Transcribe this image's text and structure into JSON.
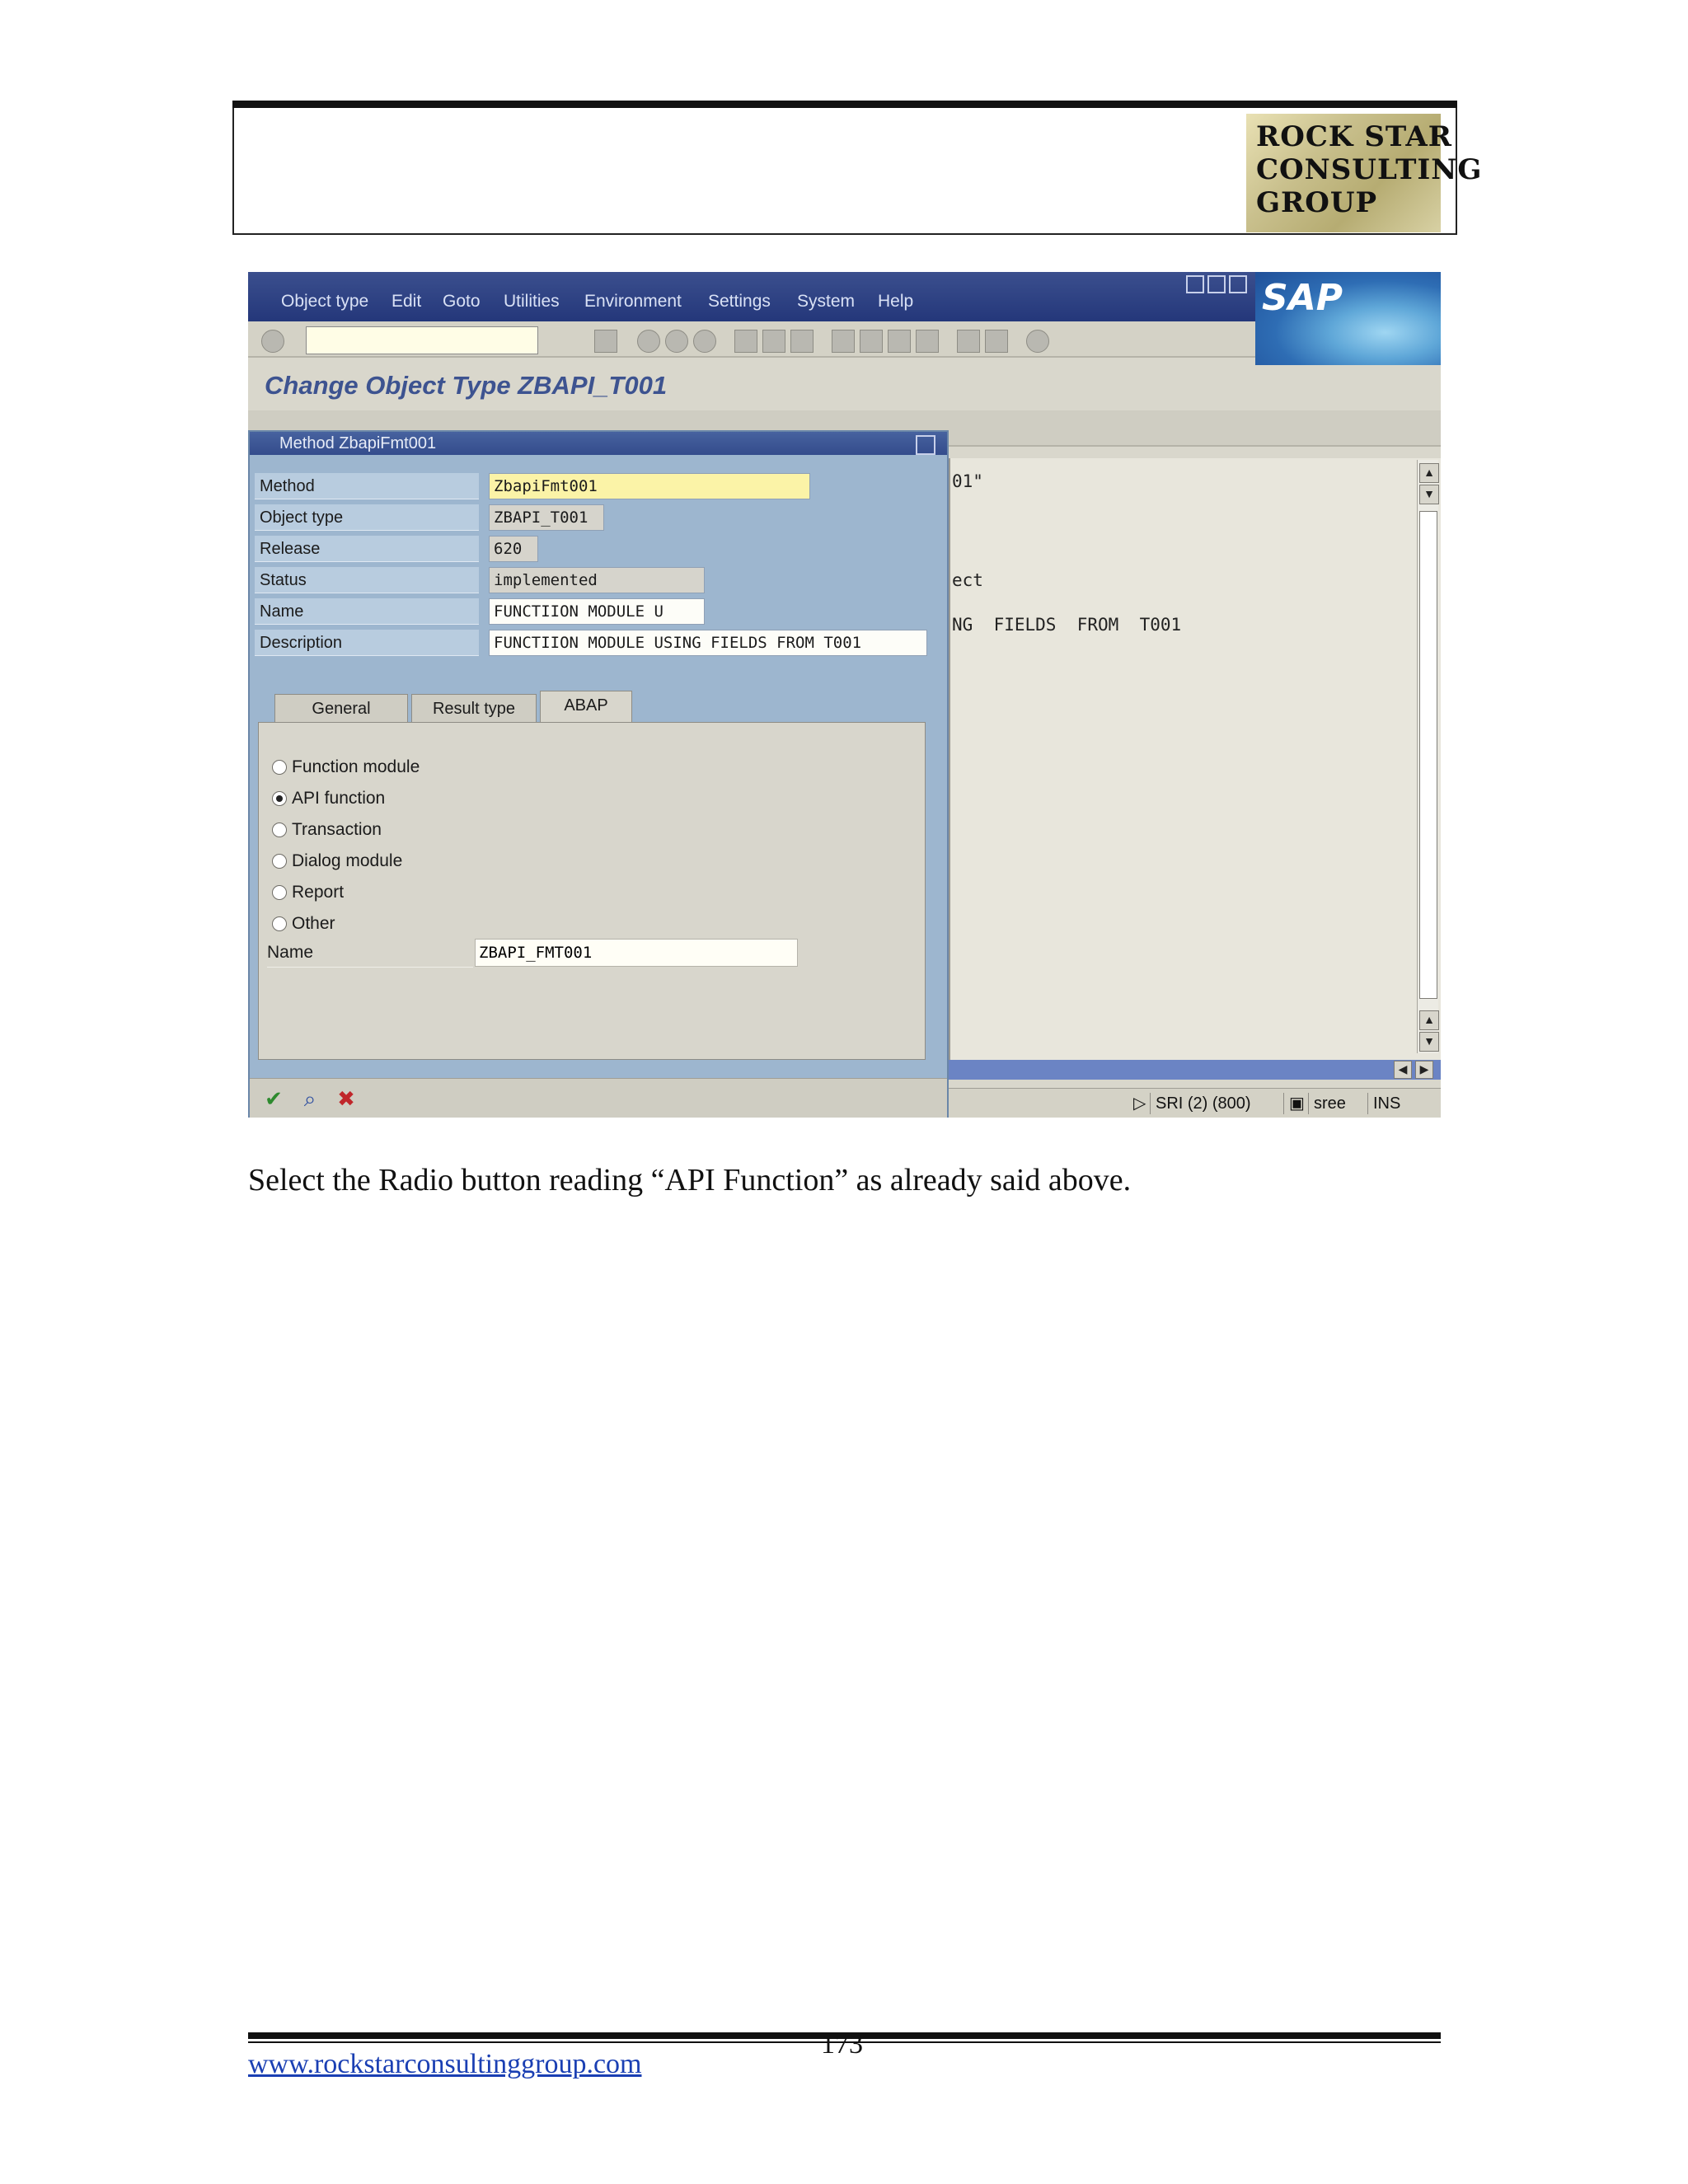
{
  "header": {
    "logo_lines": [
      "ROCK STAR",
      "CONSULTING",
      "GROUP"
    ]
  },
  "sap": {
    "menu": [
      "Object type",
      "Edit",
      "Goto",
      "Utilities",
      "Environment",
      "Settings",
      "System",
      "Help"
    ],
    "brand": "SAP",
    "screen_title": "Change Object Type ZBAPI_T001",
    "background_text": {
      "line1": "01\"",
      "line2": "ect",
      "line3": "NG  FIELDS  FROM  T001"
    },
    "status_bar": {
      "system": "SRI (2) (800)",
      "server": "sree",
      "mode": "INS"
    },
    "dialog": {
      "title": "Method ZbapiFmt001",
      "fields": {
        "method_label": "Method",
        "method_value": "ZbapiFmt001",
        "object_type_label": "Object type",
        "object_type_value": "ZBAPI_T001",
        "release_label": "Release",
        "release_value": "620",
        "status_label": "Status",
        "status_value": "implemented",
        "name_label": "Name",
        "name_value": "FUNCTIION MODULE U",
        "description_label": "Description",
        "description_value": "FUNCTIION MODULE USING FIELDS FROM T001"
      },
      "tabs": [
        "General",
        "Result type",
        "ABAP"
      ],
      "active_tab": "ABAP",
      "radios": [
        {
          "label": "Function module",
          "selected": false
        },
        {
          "label": "API function",
          "selected": true
        },
        {
          "label": "Transaction",
          "selected": false
        },
        {
          "label": "Dialog module",
          "selected": false
        },
        {
          "label": "Report",
          "selected": false
        },
        {
          "label": "Other",
          "selected": false
        }
      ],
      "abap_name_label": "Name",
      "abap_name_value": "ZBAPI_FMT001"
    }
  },
  "caption": "Select the Radio button reading “API Function” as already said above.",
  "footer": {
    "url": "www.rockstarconsultinggroup.com",
    "page_number": "173"
  }
}
